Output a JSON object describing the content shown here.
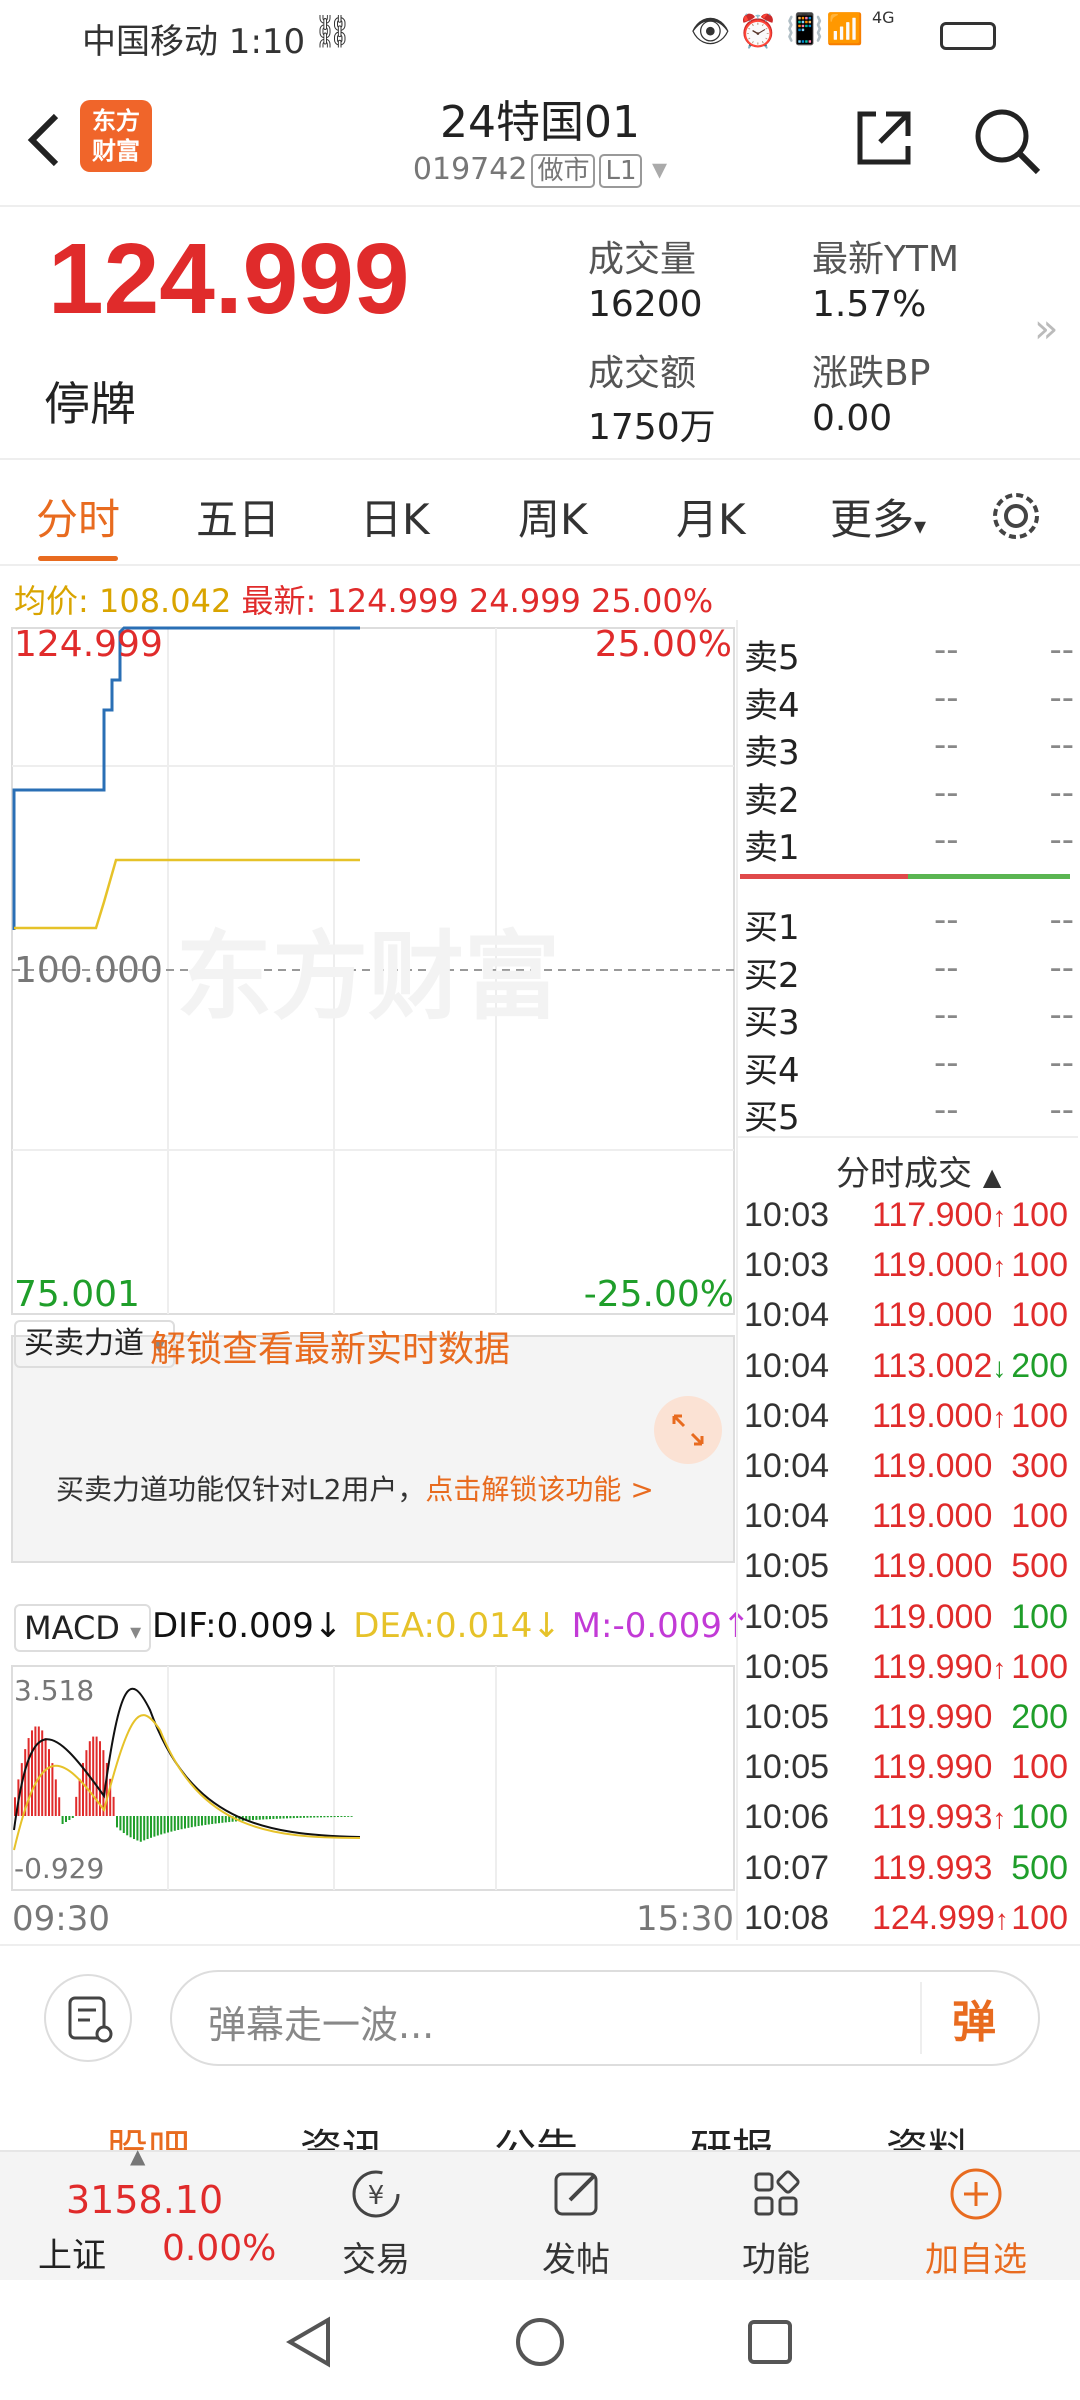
{
  "status_bar": {
    "carrier_time": "中国移动 1:10",
    "network": "4G"
  },
  "header": {
    "logo_text": "东方\n财富",
    "title": "24特国01",
    "code": "019742",
    "tag1": "做市",
    "tag2": "L1"
  },
  "quote": {
    "price": "124.999",
    "status": "停牌",
    "volume_label": "成交量",
    "volume_value": "16200",
    "ytm_label": "最新YTM",
    "ytm_value": "1.57%",
    "amount_label": "成交额",
    "amount_value": "1750万",
    "bp_label": "涨跌BP",
    "bp_value": "0.00"
  },
  "tabs": [
    "分时",
    "五日",
    "日K",
    "周K",
    "月K",
    "更多"
  ],
  "avg_line": {
    "avg_label": "均价:",
    "avg_value": "108.042",
    "latest_label": "最新:",
    "latest_value": "124.999",
    "change": "24.999",
    "change_pct": "25.00%"
  },
  "chart": {
    "top_price": "124.999",
    "top_pct": "25.00%",
    "mid_price": "100.000",
    "bottom_price": "75.001",
    "bottom_pct": "-25.00%",
    "watermark": "东方财富",
    "time_start": "09:30",
    "time_end": "15:30",
    "colors": {
      "price_line": "#2a6fb5",
      "avg_line": "#e6c229",
      "up": "#e02b2b",
      "down": "#1f9e2a"
    }
  },
  "force": {
    "selector": "买卖力道",
    "unlock_text": "解锁查看最新实时数据",
    "notice_text": "买卖力道功能仅针对L2用户，",
    "notice_link": "点击解锁该功能 >"
  },
  "macd": {
    "selector": "MACD",
    "dif": "DIF:0.009",
    "dif_arrow": "↓",
    "dea": "DEA:0.014",
    "dea_arrow": "↓",
    "m": "M:-0.009",
    "m_arrow": "↑",
    "top_value": "3.518",
    "bottom_value": "-0.929"
  },
  "order_book": {
    "sell": [
      {
        "label": "卖5",
        "price": "--",
        "vol": "--"
      },
      {
        "label": "卖4",
        "price": "--",
        "vol": "--"
      },
      {
        "label": "卖3",
        "price": "--",
        "vol": "--"
      },
      {
        "label": "卖2",
        "price": "--",
        "vol": "--"
      },
      {
        "label": "卖1",
        "price": "--",
        "vol": "--"
      }
    ],
    "buy": [
      {
        "label": "买1",
        "price": "--",
        "vol": "--"
      },
      {
        "label": "买2",
        "price": "--",
        "vol": "--"
      },
      {
        "label": "买3",
        "price": "--",
        "vol": "--"
      },
      {
        "label": "买4",
        "price": "--",
        "vol": "--"
      },
      {
        "label": "买5",
        "price": "--",
        "vol": "--"
      }
    ]
  },
  "trades": {
    "title": "分时成交",
    "rows": [
      {
        "time": "10:03",
        "price": "117.900",
        "arrow": "↑",
        "vol": "100",
        "pc": "up",
        "vc": "up"
      },
      {
        "time": "10:03",
        "price": "119.000",
        "arrow": "↑",
        "vol": "100",
        "pc": "up",
        "vc": "up"
      },
      {
        "time": "10:04",
        "price": "119.000",
        "arrow": "",
        "vol": "100",
        "pc": "up",
        "vc": "up"
      },
      {
        "time": "10:04",
        "price": "113.002",
        "arrow": "↓",
        "vol": "200",
        "pc": "up",
        "vc": "down"
      },
      {
        "time": "10:04",
        "price": "119.000",
        "arrow": "↑",
        "vol": "100",
        "pc": "up",
        "vc": "up"
      },
      {
        "time": "10:04",
        "price": "119.000",
        "arrow": "",
        "vol": "300",
        "pc": "up",
        "vc": "up"
      },
      {
        "time": "10:04",
        "price": "119.000",
        "arrow": "",
        "vol": "100",
        "pc": "up",
        "vc": "up"
      },
      {
        "time": "10:05",
        "price": "119.000",
        "arrow": "",
        "vol": "500",
        "pc": "up",
        "vc": "up"
      },
      {
        "time": "10:05",
        "price": "119.000",
        "arrow": "",
        "vol": "100",
        "pc": "up",
        "vc": "down"
      },
      {
        "time": "10:05",
        "price": "119.990",
        "arrow": "↑",
        "vol": "100",
        "pc": "up",
        "vc": "up"
      },
      {
        "time": "10:05",
        "price": "119.990",
        "arrow": "",
        "vol": "200",
        "pc": "up",
        "vc": "down"
      },
      {
        "time": "10:05",
        "price": "119.990",
        "arrow": "",
        "vol": "100",
        "pc": "up",
        "vc": "up"
      },
      {
        "time": "10:06",
        "price": "119.993",
        "arrow": "↑",
        "vol": "100",
        "pc": "up",
        "vc": "down"
      },
      {
        "time": "10:07",
        "price": "119.993",
        "arrow": "",
        "vol": "500",
        "pc": "up",
        "vc": "down"
      },
      {
        "time": "10:08",
        "price": "124.999",
        "arrow": "↑",
        "vol": "100",
        "pc": "up",
        "vc": "up"
      }
    ]
  },
  "danmu": {
    "placeholder": "弹幕走一波...",
    "send_label": "弹"
  },
  "bottom_tabs_partial": [
    "股吧",
    "资讯",
    "公告",
    "研报",
    "资料"
  ],
  "bottom_nav": {
    "index_value": "3158.10",
    "index_name": "上证",
    "index_pct": "0.00%",
    "trade": "交易",
    "post": "发帖",
    "func": "功能",
    "add": "加自选"
  }
}
